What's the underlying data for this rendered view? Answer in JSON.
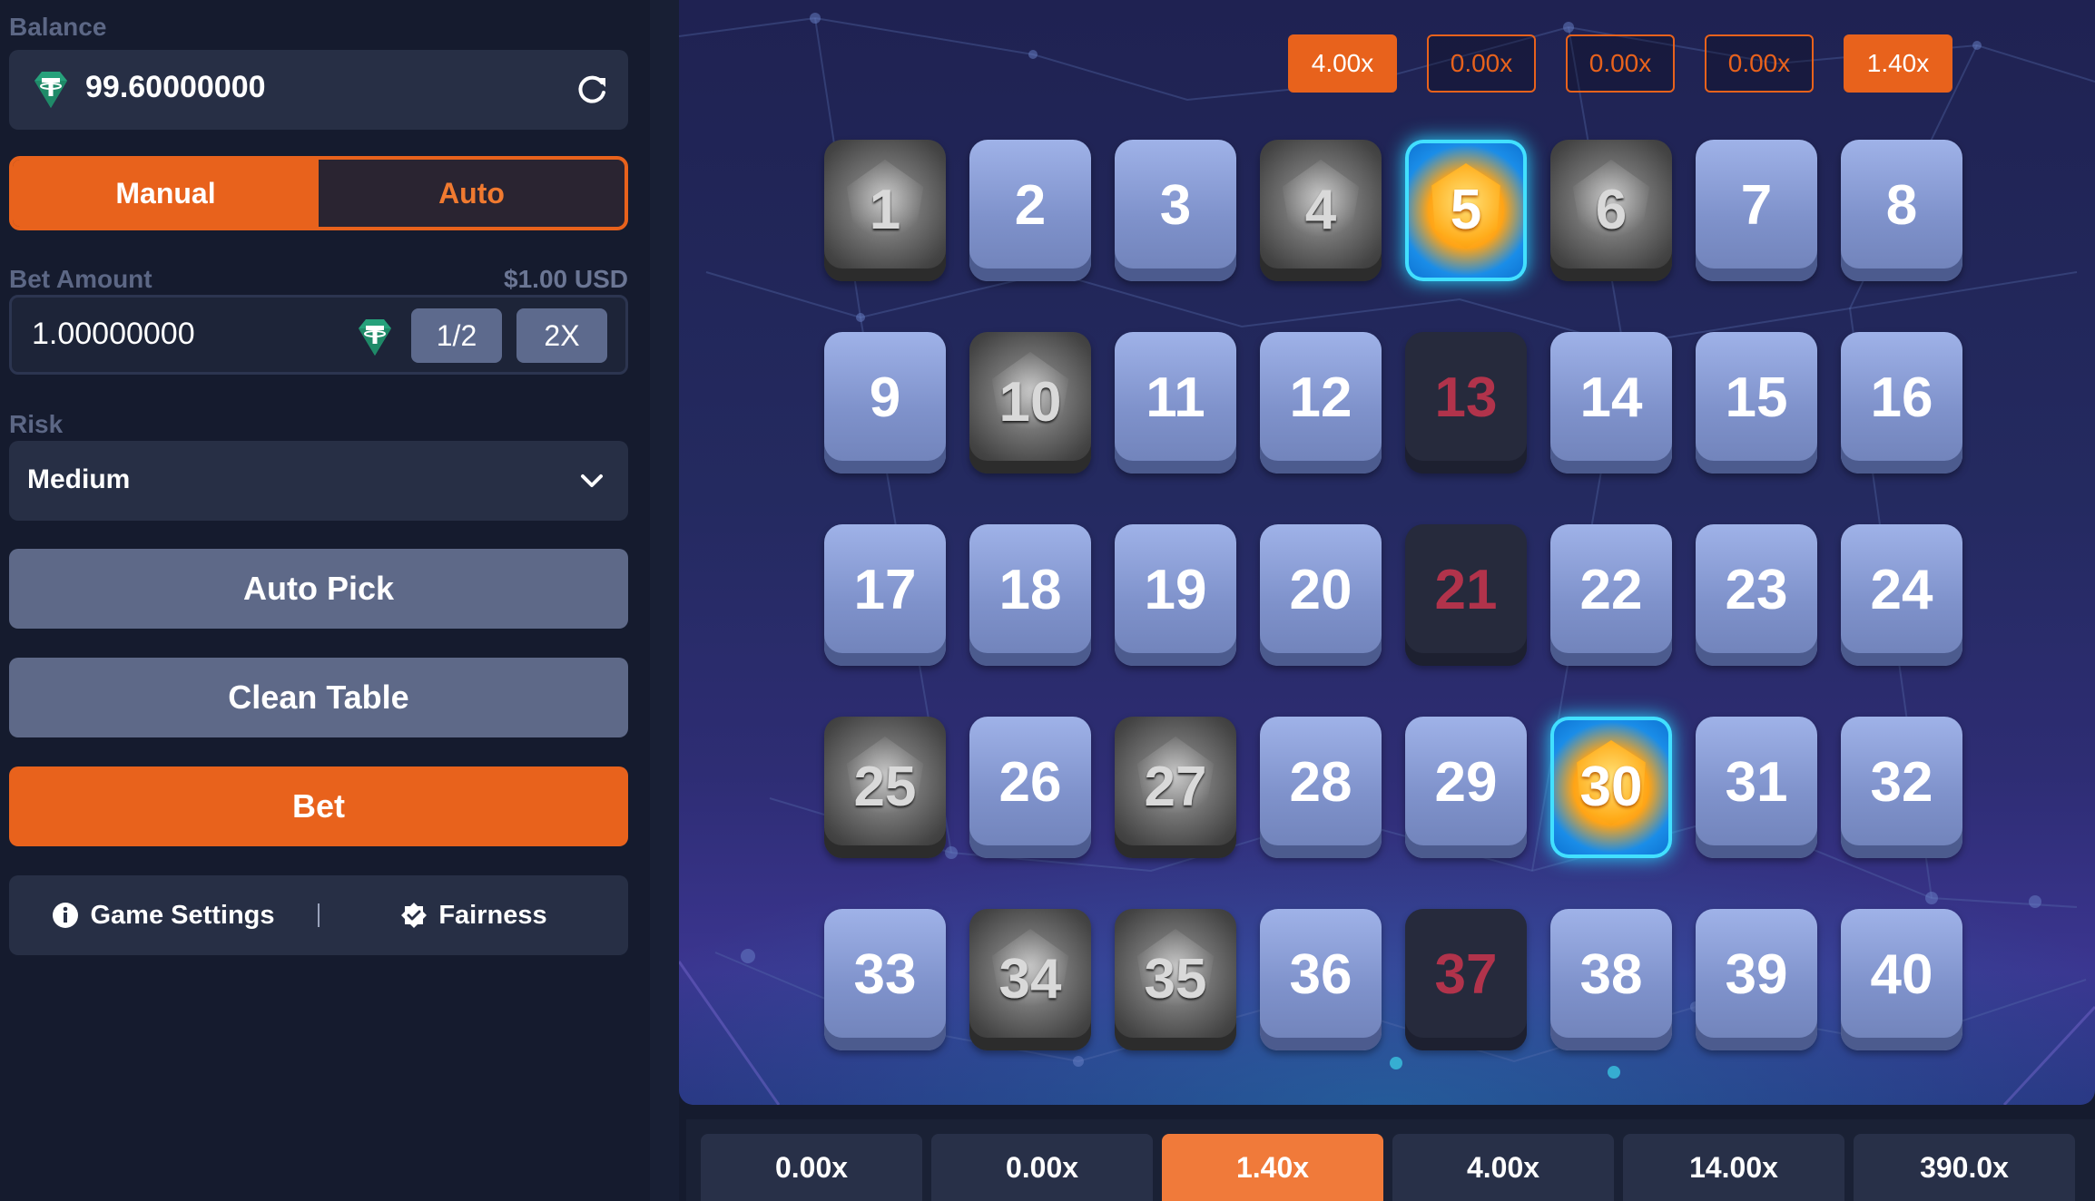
{
  "balance": {
    "label": "Balance",
    "value": "99.60000000"
  },
  "mode": {
    "manual": "Manual",
    "auto": "Auto",
    "active": "Manual"
  },
  "bet": {
    "label": "Bet Amount",
    "usd": "$1.00 USD",
    "value": "1.00000000",
    "half": "1/2",
    "double": "2X"
  },
  "risk": {
    "label": "Risk",
    "value": "Medium"
  },
  "buttons": {
    "auto_pick": "Auto Pick",
    "clean_table": "Clean Table",
    "bet": "Bet"
  },
  "footer": {
    "game_settings": "Game Settings",
    "fairness": "Fairness"
  },
  "colors": {
    "accent": "#e8621c",
    "tile": "#8193cc",
    "miss_text": "#b1334b",
    "hit_glow": "#27d3ff"
  },
  "top_multipliers": [
    {
      "label": "4.00x",
      "highlighted": true
    },
    {
      "label": "0.00x",
      "highlighted": false
    },
    {
      "label": "0.00x",
      "highlighted": false
    },
    {
      "label": "0.00x",
      "highlighted": false
    },
    {
      "label": "1.40x",
      "highlighted": true
    }
  ],
  "tiles": [
    {
      "n": "1",
      "state": "gem"
    },
    {
      "n": "2",
      "state": "plain"
    },
    {
      "n": "3",
      "state": "plain"
    },
    {
      "n": "4",
      "state": "gem"
    },
    {
      "n": "5",
      "state": "hit"
    },
    {
      "n": "6",
      "state": "gem"
    },
    {
      "n": "7",
      "state": "plain"
    },
    {
      "n": "8",
      "state": "plain"
    },
    {
      "n": "9",
      "state": "plain"
    },
    {
      "n": "10",
      "state": "gem"
    },
    {
      "n": "11",
      "state": "plain"
    },
    {
      "n": "12",
      "state": "plain"
    },
    {
      "n": "13",
      "state": "miss"
    },
    {
      "n": "14",
      "state": "plain"
    },
    {
      "n": "15",
      "state": "plain"
    },
    {
      "n": "16",
      "state": "plain"
    },
    {
      "n": "17",
      "state": "plain"
    },
    {
      "n": "18",
      "state": "plain"
    },
    {
      "n": "19",
      "state": "plain"
    },
    {
      "n": "20",
      "state": "plain"
    },
    {
      "n": "21",
      "state": "miss"
    },
    {
      "n": "22",
      "state": "plain"
    },
    {
      "n": "23",
      "state": "plain"
    },
    {
      "n": "24",
      "state": "plain"
    },
    {
      "n": "25",
      "state": "gem"
    },
    {
      "n": "26",
      "state": "plain"
    },
    {
      "n": "27",
      "state": "gem"
    },
    {
      "n": "28",
      "state": "plain"
    },
    {
      "n": "29",
      "state": "plain"
    },
    {
      "n": "30",
      "state": "hit"
    },
    {
      "n": "31",
      "state": "plain"
    },
    {
      "n": "32",
      "state": "plain"
    },
    {
      "n": "33",
      "state": "plain"
    },
    {
      "n": "34",
      "state": "gem"
    },
    {
      "n": "35",
      "state": "gem"
    },
    {
      "n": "36",
      "state": "plain"
    },
    {
      "n": "37",
      "state": "miss"
    },
    {
      "n": "38",
      "state": "plain"
    },
    {
      "n": "39",
      "state": "plain"
    },
    {
      "n": "40",
      "state": "plain"
    }
  ],
  "payouts": [
    {
      "label": "0.00x",
      "highlighted": false
    },
    {
      "label": "0.00x",
      "highlighted": false
    },
    {
      "label": "1.40x",
      "highlighted": true
    },
    {
      "label": "4.00x",
      "highlighted": false
    },
    {
      "label": "14.00x",
      "highlighted": false
    },
    {
      "label": "390.0x",
      "highlighted": false
    }
  ]
}
